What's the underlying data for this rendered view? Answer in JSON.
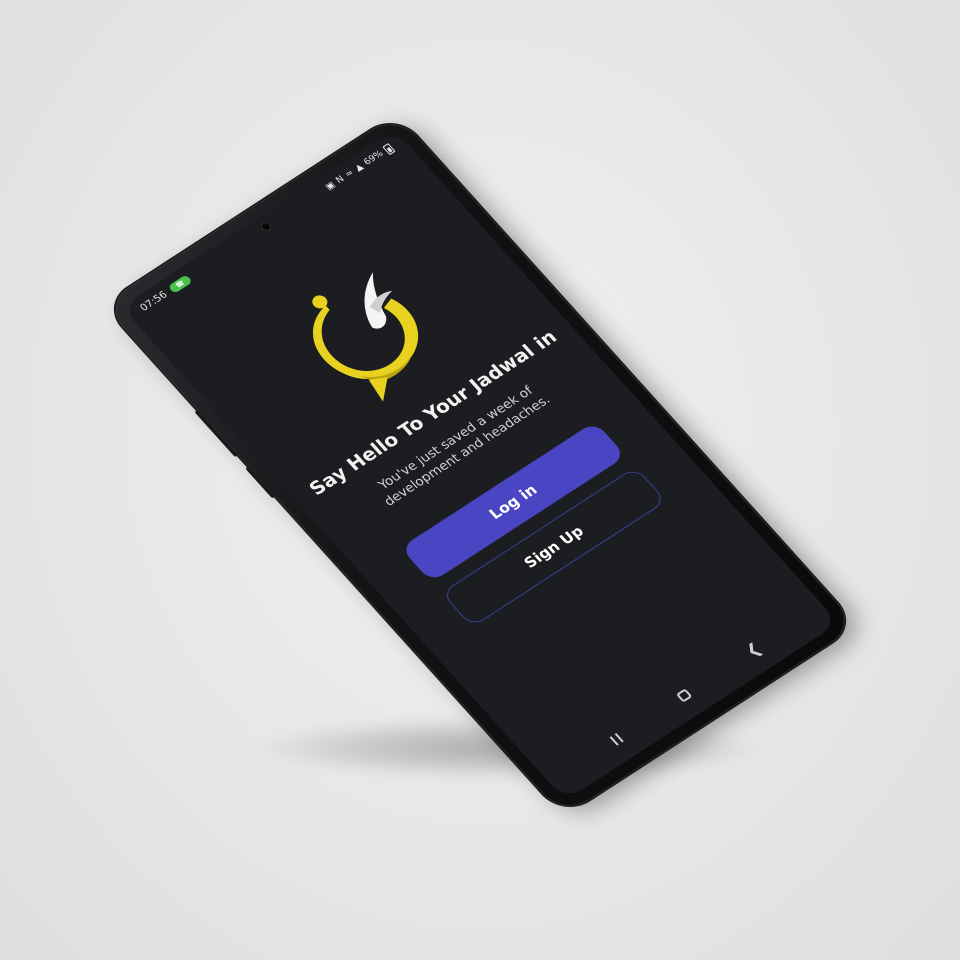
{
  "status_bar": {
    "time": "07:56",
    "icons": [
      "call-active-icon",
      "photo-icon",
      "nfc-icon",
      "wifi-icon",
      "signal-icon",
      "battery-icon"
    ],
    "battery_percent": "69%"
  },
  "welcome": {
    "title": "Say Hello To Your Jadwal in",
    "subtitle": "You've just saved a week of development and headaches."
  },
  "buttons": {
    "login_label": "Log in",
    "signup_label": "Sign Up"
  },
  "nav": {
    "icons": [
      "recents-icon",
      "home-icon",
      "back-icon"
    ]
  },
  "colors": {
    "screen_bg": "#1b1d20",
    "accent": "#4a45c2",
    "logo_yellow": "#e8d21f",
    "call_green": "#4cc04e"
  }
}
